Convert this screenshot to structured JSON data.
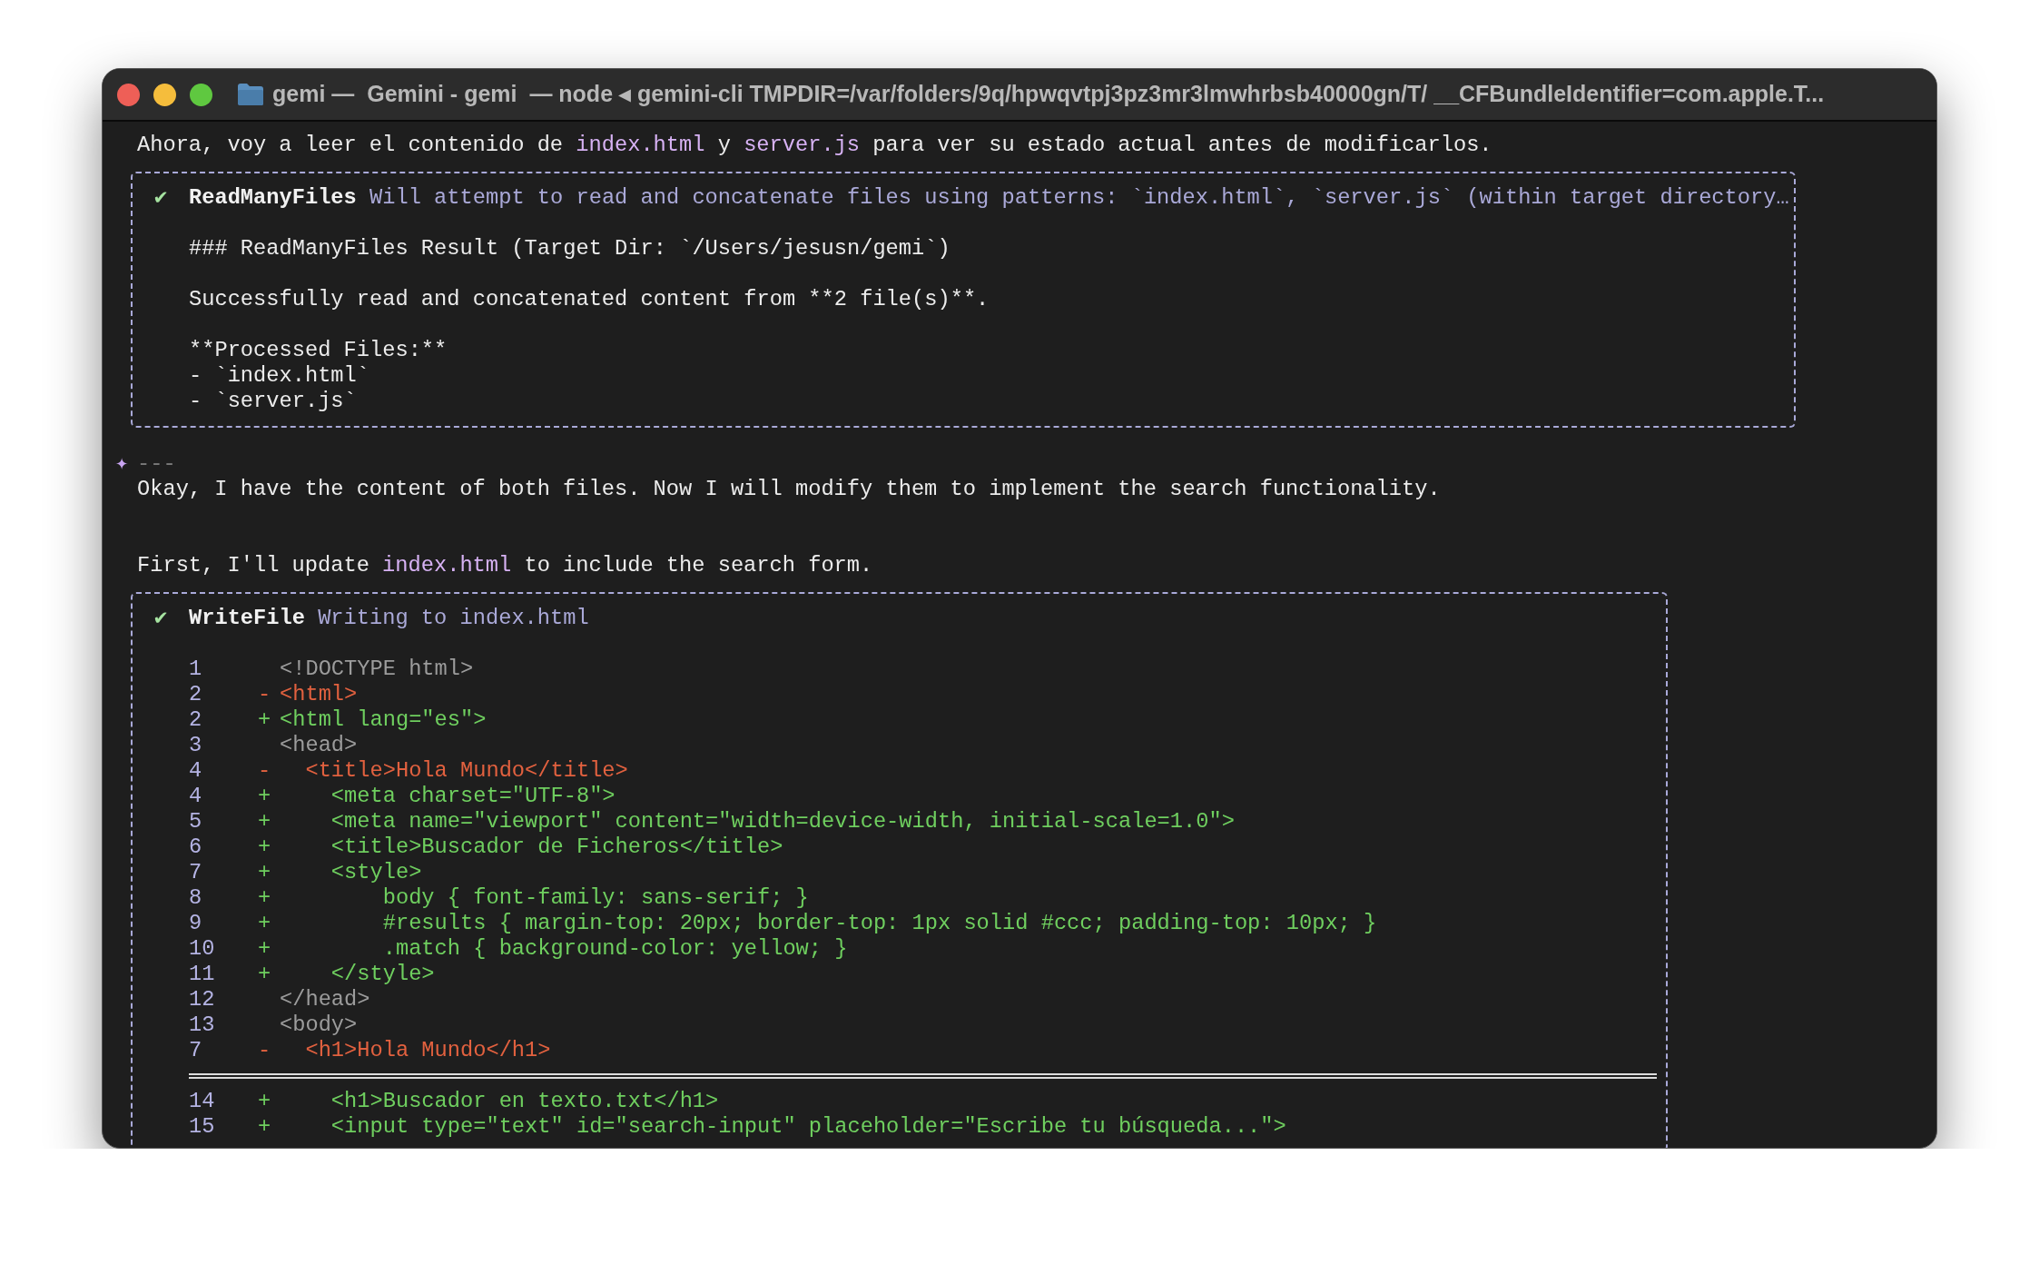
{
  "window": {
    "title": "gemi —  Gemini - gemi  — node ◂ gemini-cli TMPDIR=/var/folders/9q/hpwqvtpj3pz3mr3lmwhrbsb40000gn/T/ __CFBundleIdentifier=com.apple.T..."
  },
  "blocks": [
    {
      "kind": "message",
      "lines": [
        [
          {
            "kind": "plain",
            "text": "Ahora, voy a leer el contenido de "
          },
          {
            "kind": "path",
            "text": "index.html"
          },
          {
            "kind": "plain",
            "text": " y "
          },
          {
            "kind": "path",
            "text": "server.js"
          },
          {
            "kind": "plain",
            "text": " para ver su estado actual antes de modificarlos."
          }
        ]
      ]
    },
    {
      "kind": "tool",
      "status_icon": "✔",
      "name": "ReadManyFiles",
      "description": "Will attempt to read and concatenate files using patterns: `index.html`, `server.js` (within target directory…",
      "paragraphs": [
        [
          "### ReadManyFiles Result (Target Dir: `/Users/jesusn/gemi`)"
        ],
        [
          "Successfully read and concatenated content from **2 file(s)**."
        ],
        [
          "**Processed Files:**",
          "- `index.html`",
          "- `server.js`"
        ]
      ]
    },
    {
      "kind": "message",
      "marker": "✦",
      "lines": [
        [
          {
            "kind": "muted",
            "text": "---"
          }
        ],
        [
          {
            "kind": "plain",
            "text": "Okay, I have the content of both files. Now I will modify them to implement the search functionality."
          }
        ]
      ]
    },
    {
      "kind": "message",
      "lines": [
        [
          {
            "kind": "plain",
            "text": "First, I'll update "
          },
          {
            "kind": "path",
            "text": "index.html"
          },
          {
            "kind": "plain",
            "text": " to include the search form."
          }
        ]
      ]
    },
    {
      "kind": "diff",
      "status_icon": "✔",
      "name": "WriteFile",
      "description": "Writing to index.html",
      "rows": [
        {
          "kind": "context",
          "number": "1",
          "code": "<!DOCTYPE html>"
        },
        {
          "kind": "removed",
          "number": "2",
          "sign": "-",
          "code": "<html>"
        },
        {
          "kind": "added",
          "number": "2",
          "sign": "+",
          "code": "<html lang=\"es\">"
        },
        {
          "kind": "context",
          "number": "3",
          "code": "<head>"
        },
        {
          "kind": "removed",
          "number": "4",
          "sign": "-",
          "code": "  <title>Hola Mundo</title>"
        },
        {
          "kind": "added",
          "number": "4",
          "sign": "+",
          "code": "    <meta charset=\"UTF-8\">"
        },
        {
          "kind": "added",
          "number": "5",
          "sign": "+",
          "code": "    <meta name=\"viewport\" content=\"width=device-width, initial-scale=1.0\">"
        },
        {
          "kind": "added",
          "number": "6",
          "sign": "+",
          "code": "    <title>Buscador de Ficheros</title>"
        },
        {
          "kind": "added",
          "number": "7",
          "sign": "+",
          "code": "    <style>"
        },
        {
          "kind": "added",
          "number": "8",
          "sign": "+",
          "code": "        body { font-family: sans-serif; }"
        },
        {
          "kind": "added",
          "number": "9",
          "sign": "+",
          "code": "        #results { margin-top: 20px; border-top: 1px solid #ccc; padding-top: 10px; }"
        },
        {
          "kind": "added",
          "number": "10",
          "sign": "+",
          "code": "        .match { background-color: yellow; }"
        },
        {
          "kind": "added",
          "number": "11",
          "sign": "+",
          "code": "    </style>"
        },
        {
          "kind": "context",
          "number": "12",
          "code": "</head>"
        },
        {
          "kind": "context",
          "number": "13",
          "code": "<body>"
        },
        {
          "kind": "removed",
          "number": "7",
          "sign": "-",
          "code": "  <h1>Hola Mundo</h1>"
        },
        {
          "kind": "break"
        },
        {
          "kind": "added",
          "number": "14",
          "sign": "+",
          "code": "    <h1>Buscador en texto.txt</h1>"
        },
        {
          "kind": "added",
          "number": "15",
          "sign": "+",
          "code": "    <input type=\"text\" id=\"search-input\" placeholder=\"Escribe tu búsqueda...\">"
        }
      ]
    }
  ]
}
